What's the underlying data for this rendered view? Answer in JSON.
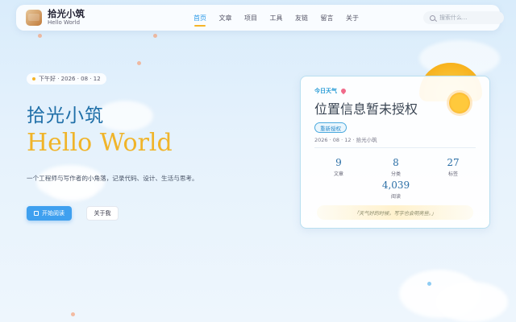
{
  "header": {
    "brand_title": "拾光小筑",
    "brand_sub": "Hello World",
    "nav": [
      "首页",
      "文章",
      "项目",
      "工具",
      "友链",
      "留言",
      "关于"
    ],
    "search_placeholder": "搜索什么..."
  },
  "hero": {
    "date": "下午好 · 2026 · 08 · 12",
    "title": "拾光小筑",
    "subtitle": "Hello World",
    "description": "一个工程师与写作者的小角落，记录代码、设计、生活与思考。",
    "btn_start": "开始阅读",
    "btn_about": "关于我"
  },
  "weather": {
    "tag": "今日天气",
    "title": "位置信息暂未授权",
    "btn_reauth": "重新授权",
    "meta": "2026 · 08 · 12 · 拾光小筑",
    "stats": [
      {
        "num": "9",
        "label": "文章"
      },
      {
        "num": "8",
        "label": "分类"
      },
      {
        "num": "27",
        "label": "标签"
      },
      {
        "num": "4,039",
        "label": "阅读"
      }
    ],
    "quote": "「天气好的时候，写字也会明亮些。」"
  },
  "colors": {
    "accent": "#3fa0ef",
    "highlight": "#f0b429",
    "title": "#1f6fa8"
  }
}
